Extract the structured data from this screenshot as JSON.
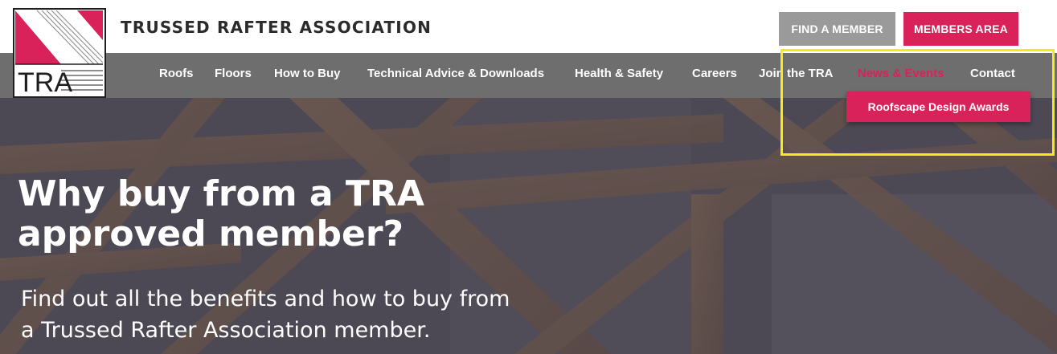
{
  "header": {
    "site_name": "TRUSSED RAFTER ASSOCIATION",
    "logo_text": "TRA",
    "find_member_label": "FIND A MEMBER",
    "members_area_label": "MEMBERS AREA"
  },
  "nav": {
    "items": [
      {
        "label": "Roofs",
        "active": false
      },
      {
        "label": "Floors",
        "active": false
      },
      {
        "label": "How to Buy",
        "active": false
      },
      {
        "label": "Technical Advice & Downloads",
        "active": false
      },
      {
        "label": "Health & Safety",
        "active": false
      },
      {
        "label": "Careers",
        "active": false
      },
      {
        "label": "Join the TRA",
        "active": false
      },
      {
        "label": "News & Events",
        "active": true
      },
      {
        "label": "Contact",
        "active": false
      }
    ],
    "dropdown_item": "Roofscape Design Awards"
  },
  "hero": {
    "title_line1": "Why buy from a TRA",
    "title_line2": "approved member?",
    "subtitle_line1": "Find out all the benefits and how to buy from",
    "subtitle_line2": "a Trussed Rafter Association member."
  },
  "colors": {
    "brand_pink": "#d9225a",
    "nav_grey": "#6e6e6e",
    "button_grey": "#9a9a9a",
    "highlight_yellow": "#f5ea1a"
  },
  "icons": [
    "tra-logo"
  ]
}
